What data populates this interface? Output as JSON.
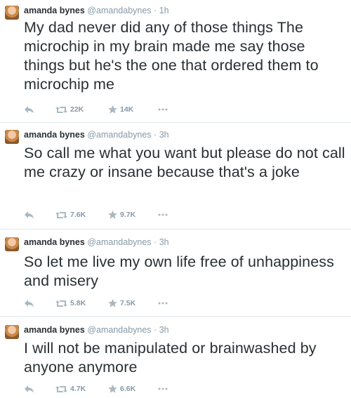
{
  "tweets": [
    {
      "name": "amanda bynes",
      "handle": "@amandabynes",
      "separator": "·",
      "time": "1h",
      "text": "My dad never did any of those things The microchip in my brain made me say those things but he's the one that ordered them to microchip me",
      "retweets": "22K",
      "favorites": "14K"
    },
    {
      "name": "amanda bynes",
      "handle": "@amandabynes",
      "separator": "·",
      "time": "3h",
      "text": "So call me what you want but please do not call me crazy or insane because that's a joke",
      "retweets": "7.6K",
      "favorites": "9.7K"
    },
    {
      "name": "amanda bynes",
      "handle": "@amandabynes",
      "separator": "·",
      "time": "3h",
      "text": "So let me live my own life free of unhappiness and misery",
      "retweets": "5.8K",
      "favorites": "7.5K"
    },
    {
      "name": "amanda bynes",
      "handle": "@amandabynes",
      "separator": "·",
      "time": "3h",
      "text": "I will not be manipulated or brainwashed by anyone anymore",
      "retweets": "4.7K",
      "favorites": "6.6K"
    }
  ],
  "icons": {
    "reply": "reply-icon",
    "retweet": "retweet-icon",
    "favorite": "star-icon",
    "more": "more-icon"
  },
  "colors": {
    "text": "#292f33",
    "meta": "#8899a6",
    "icon": "#aab8c2",
    "divider": "#e1e8ed"
  }
}
